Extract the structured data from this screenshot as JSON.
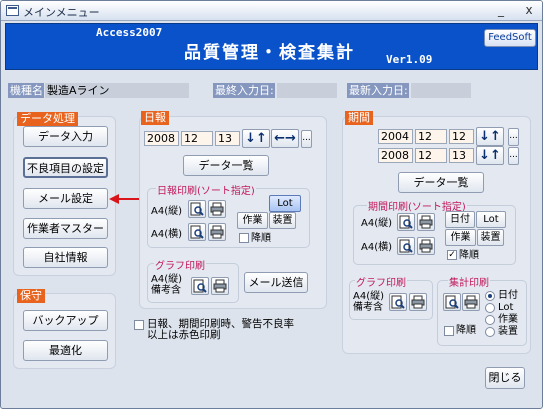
{
  "window": {
    "title": "メインメニュー",
    "minimize": "_",
    "close": "x"
  },
  "banner": {
    "subtitle": "Access2007",
    "title": "品質管理・検査集計",
    "version": "Ver1.09",
    "feedsoft_label": "FeedSoft"
  },
  "info": {
    "model_label": "機種名",
    "model_value": "製造Aライン",
    "last_input_label": "最終入力日:",
    "last_input_value": "",
    "latest_input_label": "最新入力日:",
    "latest_input_value": ""
  },
  "data_panel": {
    "title": "データ処理",
    "buttons": [
      "データ入力",
      "不良項目の設定",
      "メール設定",
      "作業者マスター",
      "自社情報"
    ]
  },
  "maint_panel": {
    "title": "保守",
    "buttons": [
      "バックアップ",
      "最適化"
    ]
  },
  "daily": {
    "title": "日報",
    "year": "2008",
    "month": "12",
    "day": "13",
    "nav_up": "↓↑",
    "nav_lr": "←→",
    "more": "...",
    "list_button": "データ一覧",
    "print_group": "日報印刷(ソート指定)",
    "portrait": "A4(縦)",
    "landscape": "A4(横)",
    "lot": "Lot",
    "work": "作業",
    "device": "装置",
    "desc": "降順",
    "desc_checked": false,
    "graph_group": "グラフ印刷",
    "graph_label_1": "A4(縦)",
    "graph_label_2": "備考含",
    "mail_button": "メール送信"
  },
  "period": {
    "title": "期間",
    "from_year": "2004",
    "from_month": "12",
    "from_day": "12",
    "to_year": "2008",
    "to_month": "12",
    "to_day": "13",
    "more": "...",
    "list_button": "データ一覧",
    "print_group": "期間印刷(ソート指定)",
    "portrait": "A4(縦)",
    "landscape": "A4(横)",
    "date": "日付",
    "lot": "Lot",
    "work": "作業",
    "device": "装置",
    "desc": "降順",
    "desc_checked": true,
    "graph_group": "グラフ印刷",
    "graph_label_1": "A4(縦)",
    "graph_label_2": "備考含",
    "summary_group": "集計印刷",
    "radio": [
      "日付",
      "Lot",
      "作業",
      "装置"
    ],
    "radio_selected": 0,
    "summary_desc": "降順"
  },
  "warn": {
    "line1": "日報、期間印刷時、警告不良率",
    "line2": "以上は赤色印刷",
    "checked": false
  },
  "close_button": "閉じる",
  "colors": {
    "banner": "#0a52c9",
    "section_title": "#e8641e",
    "arrow": "#d9141a",
    "label_bg": "#8597bf"
  }
}
